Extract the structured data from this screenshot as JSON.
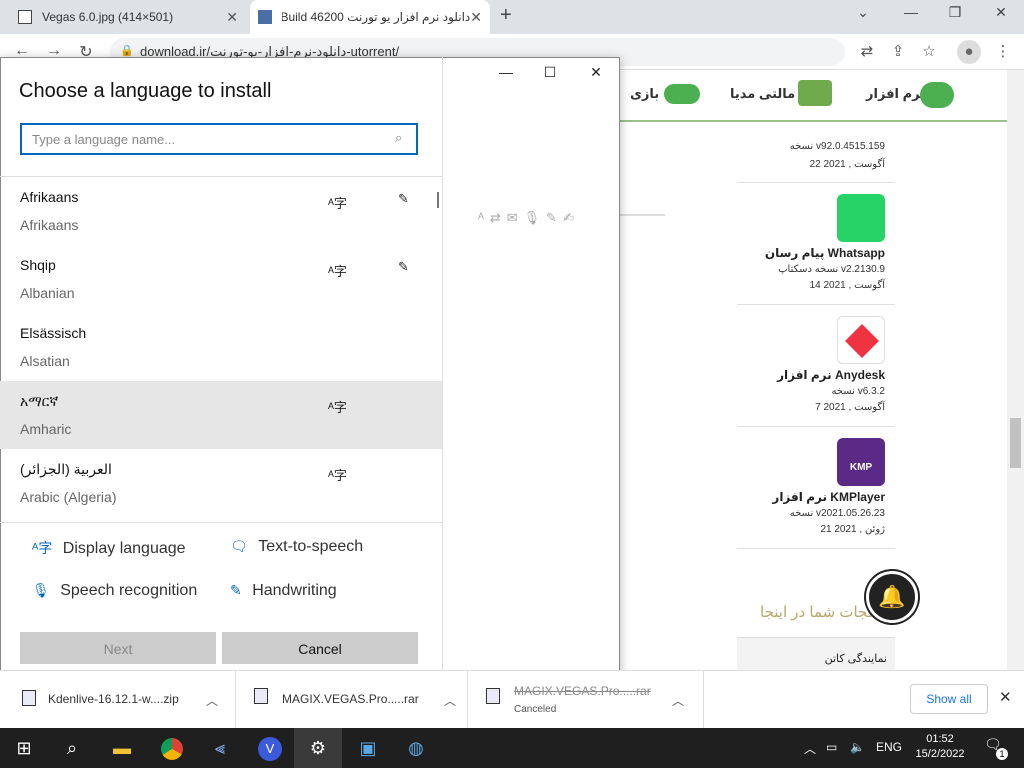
{
  "browser": {
    "tabs": [
      {
        "title": "Vegas 6.0.jpg (414×501)"
      },
      {
        "title": "دانلود نرم افزار یو تورنت 46200 Build"
      }
    ],
    "url": "download.ir/دانلود-نرم-افزار-یو-تورنت-utorrent/",
    "new_tab": "+",
    "win_controls": {
      "minimize": "⌄",
      "restore": "—",
      "maximize": "❐",
      "close": "✕"
    }
  },
  "site": {
    "nav": [
      {
        "label": "نرم افزار",
        "color": "#4caf50"
      },
      {
        "label": "مالتی مدیا",
        "color": "#6fab4c"
      },
      {
        "label": "بازی",
        "color": "#4caf50"
      }
    ],
    "apps": [
      {
        "version": "نسخه v92.0.4515.159",
        "date": "22 آگوست , 2021"
      },
      {
        "title": "پیام رسان Whatsapp",
        "version": "نسخه دسکتاپ v2.2130.9",
        "date": "14 آگوست , 2021",
        "logo_color": "#25d366"
      },
      {
        "title": "نرم افزار Anydesk",
        "version": "نسخه v6.3.2",
        "date": "7 آگوست , 2021",
        "logo_color": "#ef3340"
      },
      {
        "title": "نرم افزار KMPlayer",
        "version": "نسخه v2021.05.26.23",
        "date": "21 ژوئن , 2021",
        "logo_color": "#5b2a86"
      }
    ],
    "section_heading": "گجات شما در اینجا",
    "agency_link": "نمایندگی کاتن"
  },
  "dialog": {
    "title": "Choose a language to install",
    "search_placeholder": "Type a language name...",
    "languages": [
      {
        "native": "Afrikaans",
        "english": "Afrikaans",
        "display": true,
        "handwriting": true
      },
      {
        "native": "Shqip",
        "english": "Albanian",
        "display": true,
        "handwriting": true
      },
      {
        "native": "Elsässisch",
        "english": "Alsatian",
        "display": false,
        "handwriting": false
      },
      {
        "native": "አማርኛ",
        "english": "Amharic",
        "display": true,
        "handwriting": false,
        "selected": true
      },
      {
        "native": "العربية (الجزائر)",
        "english": "Arabic (Algeria)",
        "display": true,
        "handwriting": false
      }
    ],
    "legend": {
      "display_language": "Display language",
      "text_to_speech": "Text-to-speech",
      "speech_recognition": "Speech recognition",
      "handwriting": "Handwriting"
    },
    "next_label": "Next",
    "cancel_label": "Cancel"
  },
  "downloads": {
    "items": [
      {
        "name": "Kdenlive-16.12.1-w....zip",
        "status": ""
      },
      {
        "name": "MAGIX.VEGAS.Pro.....rar",
        "status": ""
      },
      {
        "name": "MAGIX.VEGAS.Pro.....rar",
        "status": "Canceled"
      }
    ],
    "show_all": "Show all"
  },
  "taskbar": {
    "lang": "ENG",
    "time": "01:52",
    "date": "15/2/2022",
    "notifications": "1"
  }
}
